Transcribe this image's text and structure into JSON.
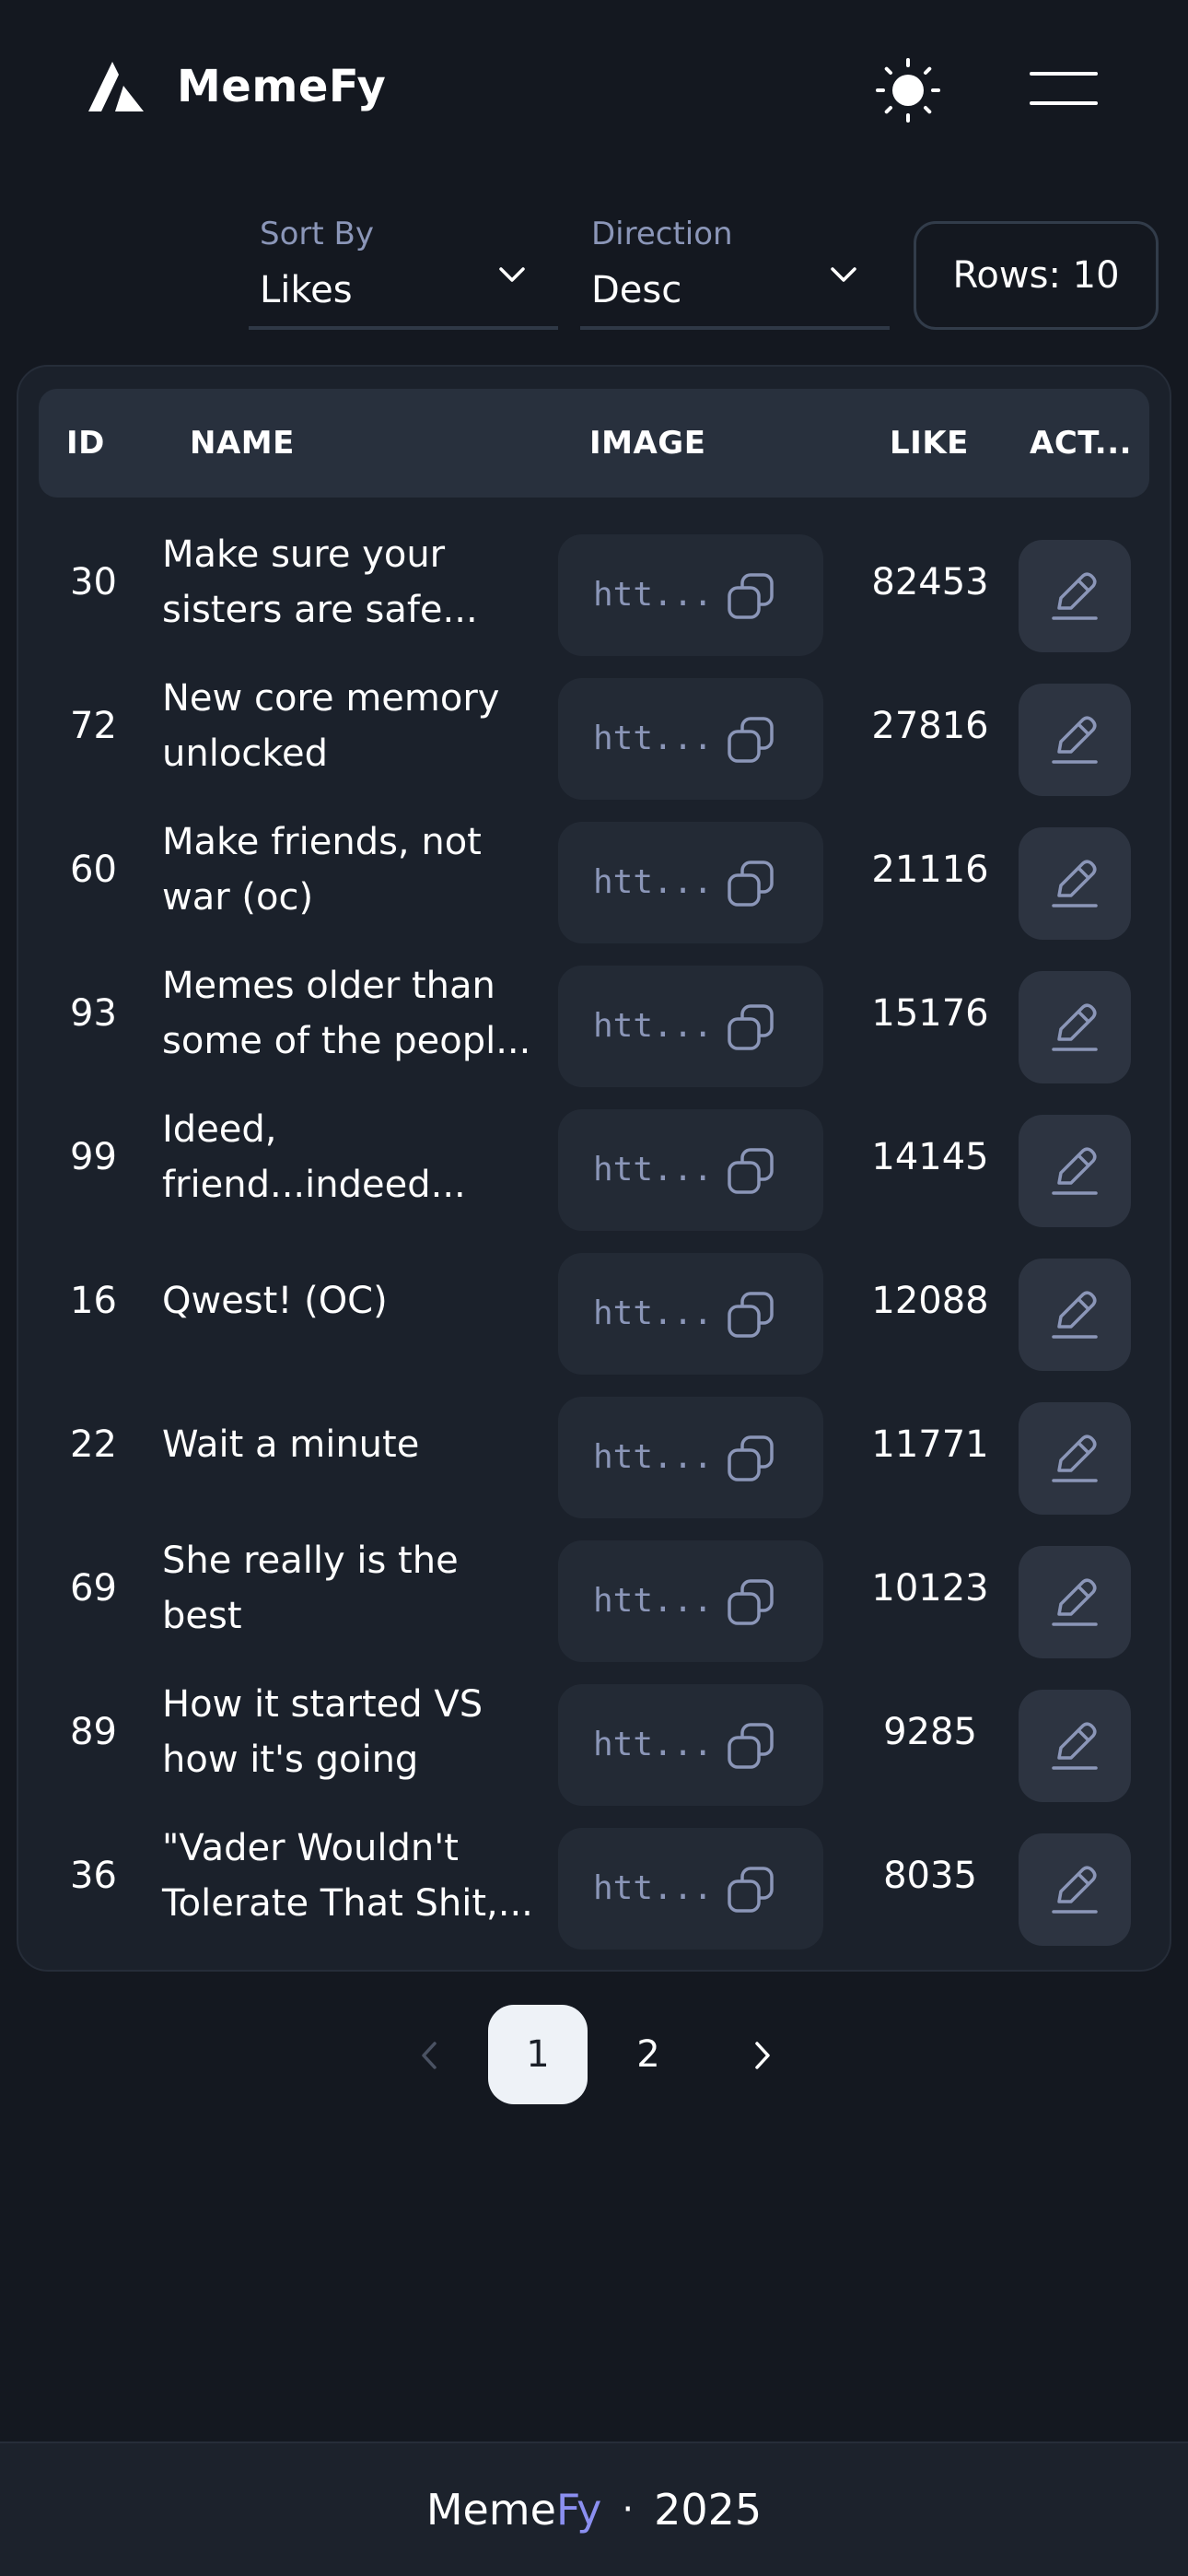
{
  "app": {
    "name": "MemeFy",
    "logo_icon": "memefy-logo-icon",
    "theme_icon": "sun-icon",
    "menu_icon": "hamburger-menu-icon"
  },
  "controls": {
    "sort": {
      "label": "Sort By",
      "value": "Likes"
    },
    "direction": {
      "label": "Direction",
      "value": "Desc"
    },
    "rows_label": "Rows: 10"
  },
  "table": {
    "headers": {
      "id": "ID",
      "name": "NAME",
      "image": "IMAGE",
      "like": "LIKE",
      "actions": "ACT..."
    },
    "rows": [
      {
        "id": "30",
        "name": "Make sure your sisters are safe...",
        "image": "htt...",
        "like": "82453"
      },
      {
        "id": "72",
        "name": "New core memory unlocked",
        "image": "htt...",
        "like": "27816"
      },
      {
        "id": "60",
        "name": "Make friends, not war (oc)",
        "image": "htt...",
        "like": "21116"
      },
      {
        "id": "93",
        "name": "Memes older than some of the peopl...",
        "image": "htt...",
        "like": "15176"
      },
      {
        "id": "99",
        "name": "Ideed, friend...indeed...",
        "image": "htt...",
        "like": "14145"
      },
      {
        "id": "16",
        "name": "Qwest! (OC)",
        "image": "htt...",
        "like": "12088"
      },
      {
        "id": "22",
        "name": "Wait a minute",
        "image": "htt...",
        "like": "11771"
      },
      {
        "id": "69",
        "name": "She really is the best",
        "image": "htt...",
        "like": "10123"
      },
      {
        "id": "89",
        "name": "How it started VS how it's going",
        "image": "htt...",
        "like": "9285"
      },
      {
        "id": "36",
        "name": "\"Vader Wouldn't Tolerate That Shit,...",
        "image": "htt...",
        "like": "8035"
      }
    ]
  },
  "pagination": {
    "pages": [
      "1",
      "2"
    ],
    "current": "1"
  },
  "footer": {
    "brand_main": "Meme",
    "brand_accent": "Fy",
    "separator": "·",
    "year": "2025"
  },
  "colors": {
    "background": "#141820",
    "card": "#1b212b",
    "header_row": "#28303d",
    "muted_text": "#8b96b8",
    "accent": "#8b8ff0",
    "active_page": "#eef2f7"
  }
}
